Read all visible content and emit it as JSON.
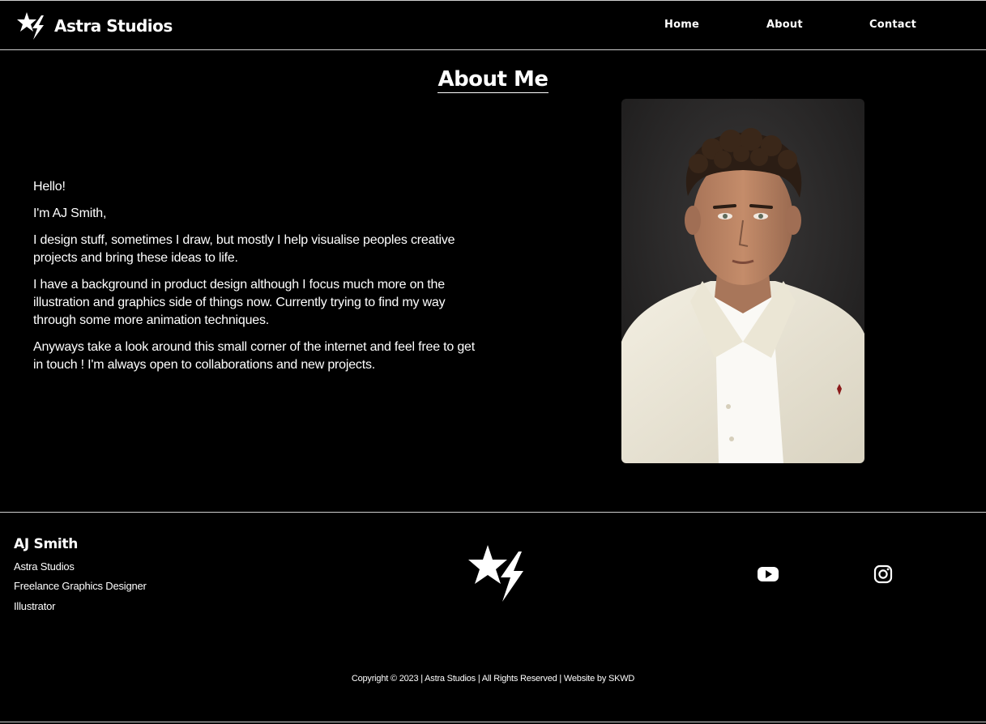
{
  "header": {
    "brand": "Astra Studios",
    "nav": [
      {
        "label": "Home"
      },
      {
        "label": "About"
      },
      {
        "label": "Contact"
      }
    ]
  },
  "main": {
    "title": "About Me",
    "paragraphs": [
      "Hello!",
      "I'm AJ Smith,",
      "I design stuff, sometimes I draw, but mostly I help visualise peoples creative projects and bring these ideas to life.",
      "I have a background in product design although I focus much more on the illustration and graphics side of things now. Currently trying to find my way through some more animation techniques.",
      "Anyways take a look around this small corner of the internet and feel free to get in touch ! I'm always open to collaborations and new projects."
    ],
    "portrait": {
      "subject": "portrait-photo"
    }
  },
  "footer": {
    "name": "AJ Smith",
    "lines": [
      "Astra Studios",
      "Freelance Graphics Designer",
      "Illustrator"
    ],
    "social": [
      {
        "icon": "youtube-icon"
      },
      {
        "icon": "instagram-icon"
      }
    ],
    "copyright": "Copyright © 2023 | Astra Studios | All Rights Reserved | Website by SKWD"
  },
  "colors": {
    "background": "#000000",
    "text": "#ffffff",
    "divider": "#cfcfcf"
  }
}
